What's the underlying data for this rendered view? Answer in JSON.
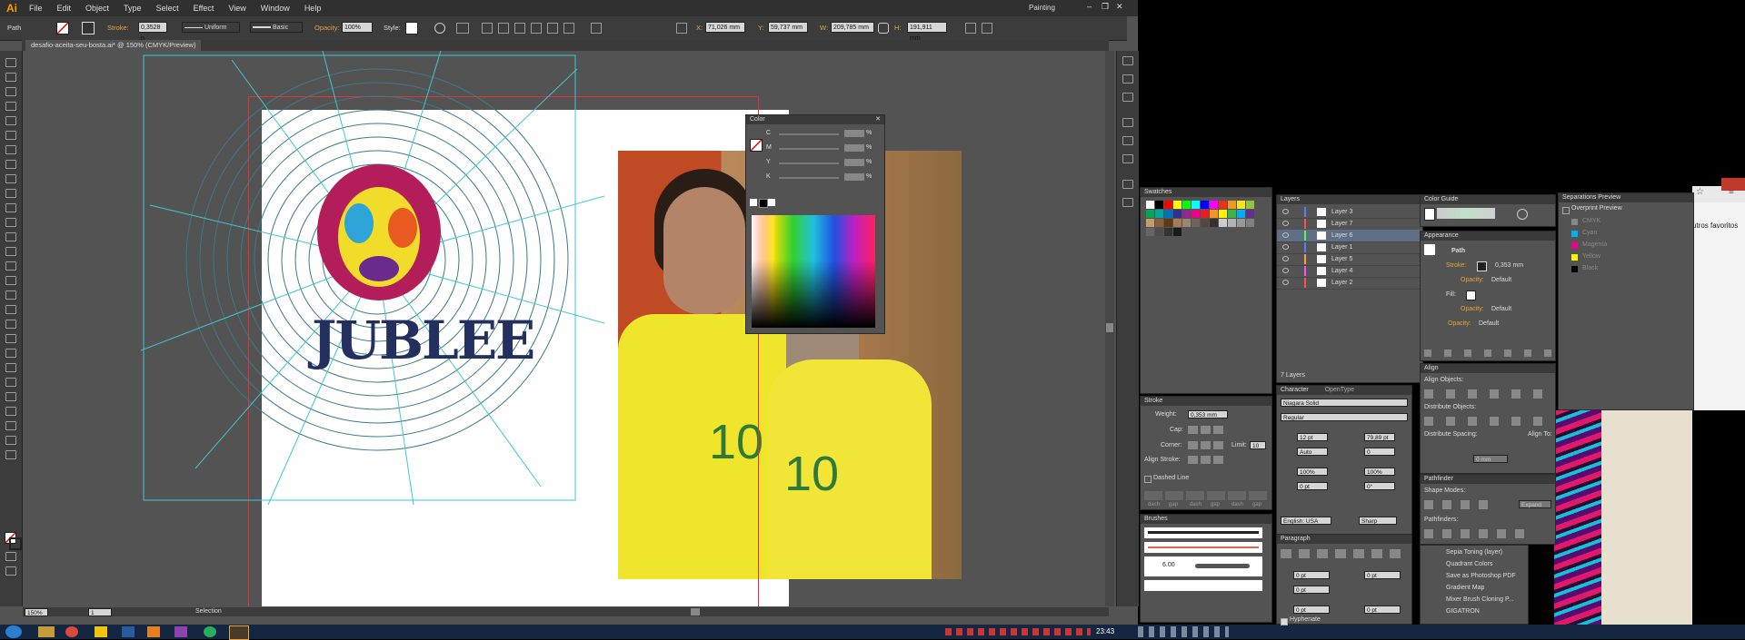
{
  "app": {
    "logo": "Ai",
    "workspace": "Painting",
    "menu": [
      "File",
      "Edit",
      "Object",
      "Type",
      "Select",
      "Effect",
      "View",
      "Window",
      "Help"
    ]
  },
  "control_bar": {
    "object_type": "Path",
    "stroke_label": "Stroke:",
    "stroke_value": "0,3528 n",
    "profile": "Uniform",
    "brush": "Basic",
    "opacity_label": "Opacity:",
    "opacity_value": "100%",
    "style_label": "Style:",
    "x_label": "X:",
    "x_value": "71,026 mm",
    "y_label": "Y:",
    "y_value": "59,737 mm",
    "w_label": "W:",
    "w_value": "209,785 mm",
    "h_label": "H:",
    "h_value": "191,911 mm"
  },
  "document": {
    "tab_title": "desafio-aceita-seu-bosta.ai* @ 150% (CMYK/Preview)",
    "zoom": "150%",
    "page": "1",
    "status": "Selection"
  },
  "artwork": {
    "logo_text": "JUBLEE",
    "jersey_number_1": "10",
    "jersey_number_2": "10"
  },
  "color_panel": {
    "title": "Color",
    "channels": [
      {
        "label": "C",
        "value": "",
        "unit": "%"
      },
      {
        "label": "M",
        "value": "",
        "unit": "%"
      },
      {
        "label": "Y",
        "value": "",
        "unit": "%"
      },
      {
        "label": "K",
        "value": "",
        "unit": "%"
      }
    ]
  },
  "swatches_panel": {
    "title": "Swatches",
    "colors": [
      "#ffffff",
      "#000000",
      "#ff0000",
      "#ffff00",
      "#00ff00",
      "#00ffff",
      "#0000ff",
      "#ff00ff",
      "#e8321c",
      "#f29a1f",
      "#fbe21a",
      "#8dc63f",
      "#00a551",
      "#00a99d",
      "#0072bc",
      "#2e3192",
      "#92278f",
      "#ec008c",
      "#ed1c24",
      "#f7941d",
      "#fff200",
      "#39b54a",
      "#00aeef",
      "#662d91",
      "#c69c6d",
      "#8b5e3c",
      "#603913",
      "#a67c52",
      "#998675",
      "#736357",
      "#534741",
      "#362f2d",
      "#cccccc",
      "#b3b3b3",
      "#999999",
      "#808080",
      "#666666",
      "#4d4d4d",
      "#333333",
      "#1a1a1a"
    ]
  },
  "stroke_panel": {
    "title": "Stroke",
    "weight_label": "Weight:",
    "weight_value": "0,353 mm",
    "cap_label": "Cap:",
    "corner_label": "Corner:",
    "limit_label": "Limit:",
    "limit_value": "10",
    "align_label": "Align Stroke:",
    "dashed_label": "Dashed Line",
    "dash_labels": [
      "dash",
      "gap",
      "dash",
      "gap",
      "dash",
      "gap"
    ]
  },
  "brushes_panel": {
    "title": "Brushes",
    "size_value": "6.00"
  },
  "layers_panel": {
    "title": "Layers",
    "layers": [
      {
        "name": "Layer 3",
        "color": "#4f7fff"
      },
      {
        "name": "Layer 7",
        "color": "#ff4f4f"
      },
      {
        "name": "Layer 6",
        "color": "#4fff4f"
      },
      {
        "name": "Layer 1",
        "color": "#4f7fff"
      },
      {
        "name": "Layer 5",
        "color": "#ff9a3f"
      },
      {
        "name": "Layer 4",
        "color": "#ff4fff"
      },
      {
        "name": "Layer 2",
        "color": "#ff4f4f"
      }
    ],
    "footer": "7 Layers"
  },
  "character_panel": {
    "title": "Character",
    "tab2": "OpenType",
    "font": "Niagara Solid",
    "style": "Regular",
    "size": "12 pt",
    "leading": "79,89 pt",
    "kerning": "Auto",
    "tracking": "0",
    "vscale": "100%",
    "hscale": "100%",
    "baseline": "0 pt",
    "rotation": "0°",
    "language": "English: USA",
    "aa": "Sharp"
  },
  "paragraph_panel": {
    "title": "Paragraph",
    "indent_values": [
      "0 pt",
      "0 pt",
      "0 pt",
      "0 pt",
      "0 pt",
      "0 pt"
    ],
    "hyphenate": "Hyphenate"
  },
  "color_guide_panel": {
    "title": "Color Guide"
  },
  "appearance_panel": {
    "title": "Appearance",
    "object": "Path",
    "rows": [
      {
        "label": "Stroke:",
        "value": "0,353 mm"
      },
      {
        "label": "Opacity:",
        "value": "Default"
      },
      {
        "label": "Fill:",
        "value": ""
      },
      {
        "label": "Opacity:",
        "value": "Default"
      },
      {
        "label": "Opacity:",
        "value": "Default"
      }
    ]
  },
  "align_panel": {
    "title": "Align",
    "align_objects": "Align Objects:",
    "distribute_objects": "Distribute Objects:",
    "distribute_spacing": "Distribute Spacing:",
    "align_to": "Align To:",
    "spacing_value": "0 mm"
  },
  "pathfinder_panel": {
    "title": "Pathfinder",
    "shape_modes": "Shape Modes:",
    "expand": "Expand",
    "pathfinders": "Pathfinders:"
  },
  "actions_panel": {
    "items": [
      "Sepia Toning (layer)",
      "Quadrant Colors",
      "Save as Photoshop PDF",
      "Gradient Map",
      "Mixer Brush Cloning P...",
      "GIGATRON"
    ]
  },
  "separations_panel": {
    "title": "Separations Preview",
    "overprint": "Overprint Preview",
    "plates": [
      {
        "name": "CMYK",
        "color": "#888888"
      },
      {
        "name": "Cyan",
        "color": "#00aeef"
      },
      {
        "name": "Magenta",
        "color": "#ec008c"
      },
      {
        "name": "Yellow",
        "color": "#fff200"
      },
      {
        "name": "Black",
        "color": "#000000"
      }
    ]
  },
  "browser": {
    "bookmark_text": "utros favoritos"
  },
  "taskbar": {
    "clock": "23:43"
  }
}
